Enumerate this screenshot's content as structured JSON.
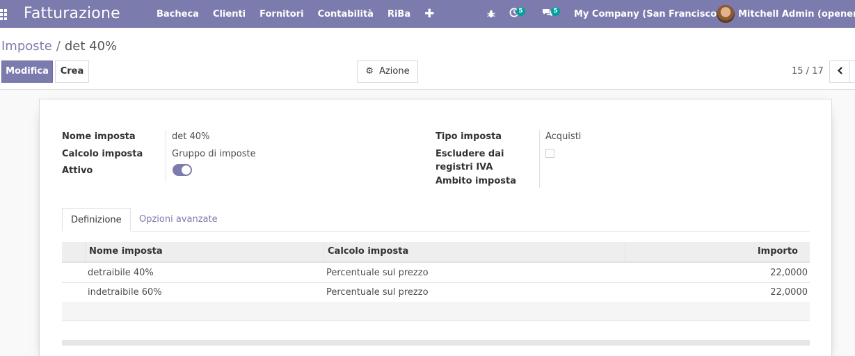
{
  "navbar": {
    "brand": "Fatturazione",
    "menu": [
      {
        "label": "Bacheca"
      },
      {
        "label": "Clienti"
      },
      {
        "label": "Fornitori"
      },
      {
        "label": "Contabilità"
      },
      {
        "label": "RiBa"
      }
    ],
    "add_icon": "plus-icon",
    "activity_count": "5",
    "message_count": "5",
    "company": "My Company (San Francisco)",
    "user_name": "Mitchell Admin (openerp_te"
  },
  "breadcrumb": {
    "parent": "Imposte",
    "separator": "/",
    "current": "det 40%"
  },
  "buttons": {
    "edit": "Modifica",
    "create": "Crea",
    "action": "Azione"
  },
  "pager": {
    "value": "15 / 17"
  },
  "form": {
    "left": [
      {
        "label": "Nome imposta",
        "value": "det 40%"
      },
      {
        "label": "Calcolo imposta",
        "value": "Gruppo di imposte"
      },
      {
        "label": "Attivo",
        "value": ""
      }
    ],
    "active": true,
    "right": [
      {
        "label": "Tipo imposta",
        "value": "Acquisti"
      },
      {
        "label": "Escludere dai registri IVA",
        "label_line1": "Escludere dai",
        "label_line2": "registri IVA"
      },
      {
        "label": "Ambito imposta",
        "value": ""
      }
    ],
    "exclude_from_vat": false
  },
  "tabs": [
    {
      "label": "Definizione",
      "active": true
    },
    {
      "label": "Opzioni avanzate",
      "active": false
    }
  ],
  "table": {
    "columns": [
      "Nome imposta",
      "Calcolo imposta",
      "Importo"
    ],
    "rows": [
      {
        "name": "detraibile 40%",
        "calc": "Percentuale sul prezzo",
        "amount": "22,0000"
      },
      {
        "name": "indetraibile 60%",
        "calc": "Percentuale sul prezzo",
        "amount": "22,0000"
      }
    ]
  },
  "colors": {
    "brand": "#7c7bad",
    "badge": "#00a09d"
  }
}
